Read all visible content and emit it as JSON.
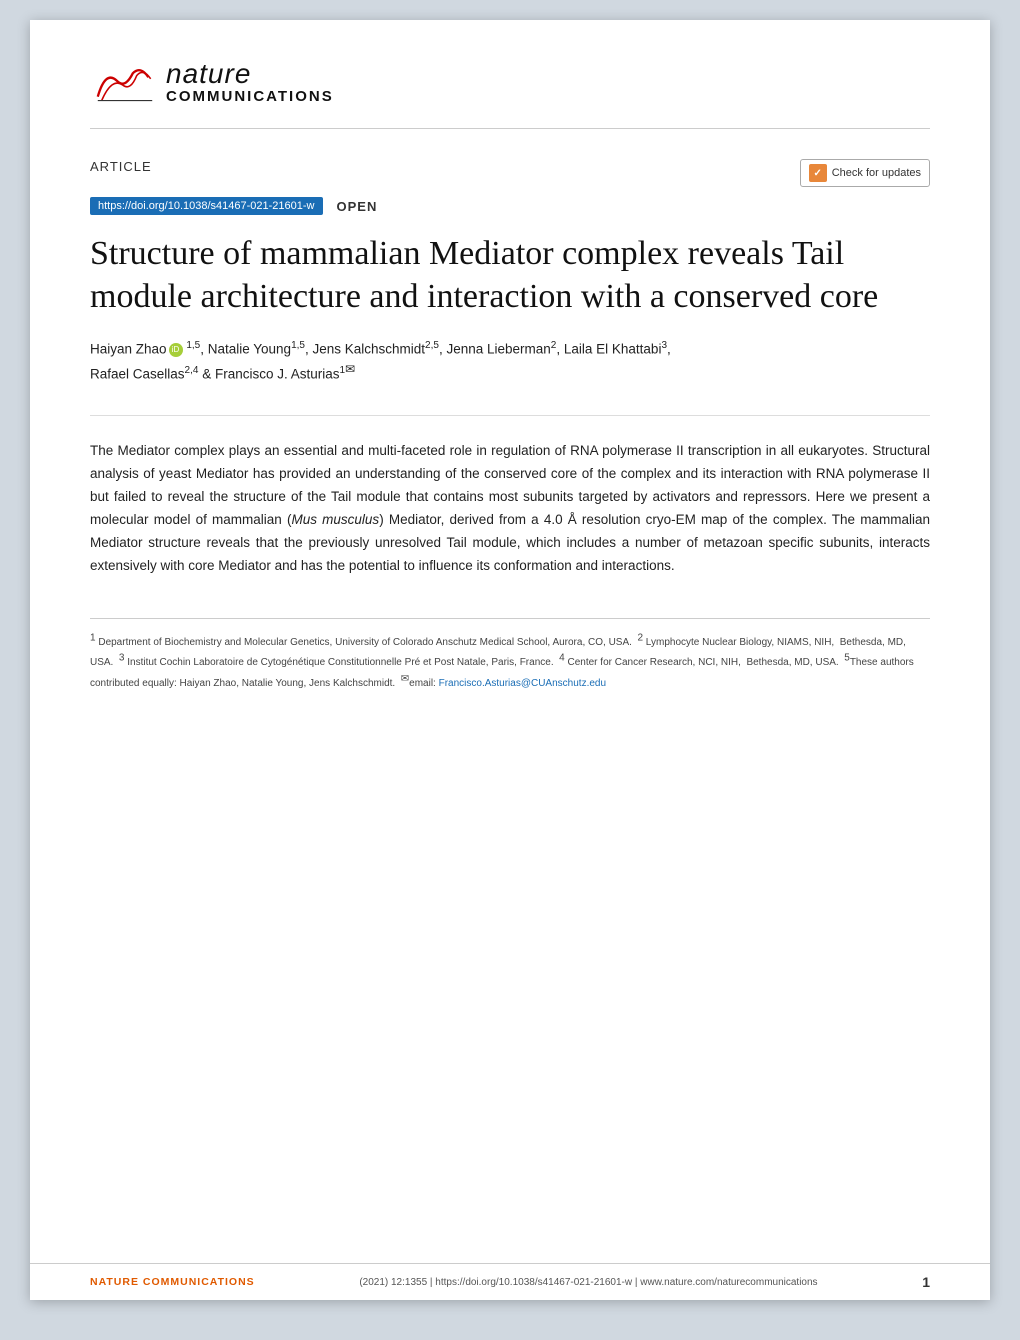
{
  "journal": {
    "name": "nature",
    "subtitle": "COMMUNICATIONS",
    "footer_name": "NATURE COMMUNICATIONS"
  },
  "article": {
    "type_label": "ARTICLE",
    "doi_text": "https://doi.org/10.1038/s41467-021-21601-w",
    "open_label": "OPEN",
    "check_updates_label": "Check for updates",
    "title": "Structure of mammalian Mediator complex reveals Tail module architecture and interaction with a conserved core",
    "authors_text": "Haiyan Zhao",
    "authors_superscripts": "1,5",
    "abstract": "The Mediator complex plays an essential and multi-faceted role in regulation of RNA polymerase II transcription in all eukaryotes. Structural analysis of yeast Mediator has provided an understanding of the conserved core of the complex and its interaction with RNA polymerase II but failed to reveal the structure of the Tail module that contains most subunits targeted by activators and repressors. Here we present a molecular model of mammalian (Mus musculus) Mediator, derived from a 4.0 Å resolution cryo-EM map of the complex. The mammalian Mediator structure reveals that the previously unresolved Tail module, which includes a number of metazoan specific subunits, interacts extensively with core Mediator and has the potential to influence its conformation and interactions.",
    "full_authors": "Haiyan Zhao Ⓘ ¹ʸ⁵, Natalie Young¹ʸ⁵, Jens Kalchschmidt²ʸ⁵, Jenna Lieberman², Laila El Khattabi³, Rafael Casellas²ʸ⁴ & Francisco J. Asturias¹✉"
  },
  "footnotes": {
    "line1": "¹ Department of Biochemistry and Molecular Genetics, University of Colorado Anschutz Medical School, Aurora, CO, USA.  ² Lymphocyte Nuclear Biology, NIAMS, NIH,  Bethesda, MD, USA.  ³ Institut Cochin Laboratoire de Cytogénétique Constitutionnelle Pré et Post Natale, Paris, France.  ⁴ Center for Cancer Research, NCI, NIH,  Bethesda, MD, USA.  ⁵These authors contributed equally: Haiyan Zhao, Natalie Young, Jens Kalchschmidt.  ✉email: Francisco.Asturias@CUAnschutz.edu"
  },
  "footer": {
    "journal_label": "NATURE COMMUNICATIONS",
    "center_text": "(2021) 12:1355  |  https://doi.org/10.1038/s41467-021-21601-w  |  www.nature.com/naturecommunications",
    "page_number": "1"
  }
}
